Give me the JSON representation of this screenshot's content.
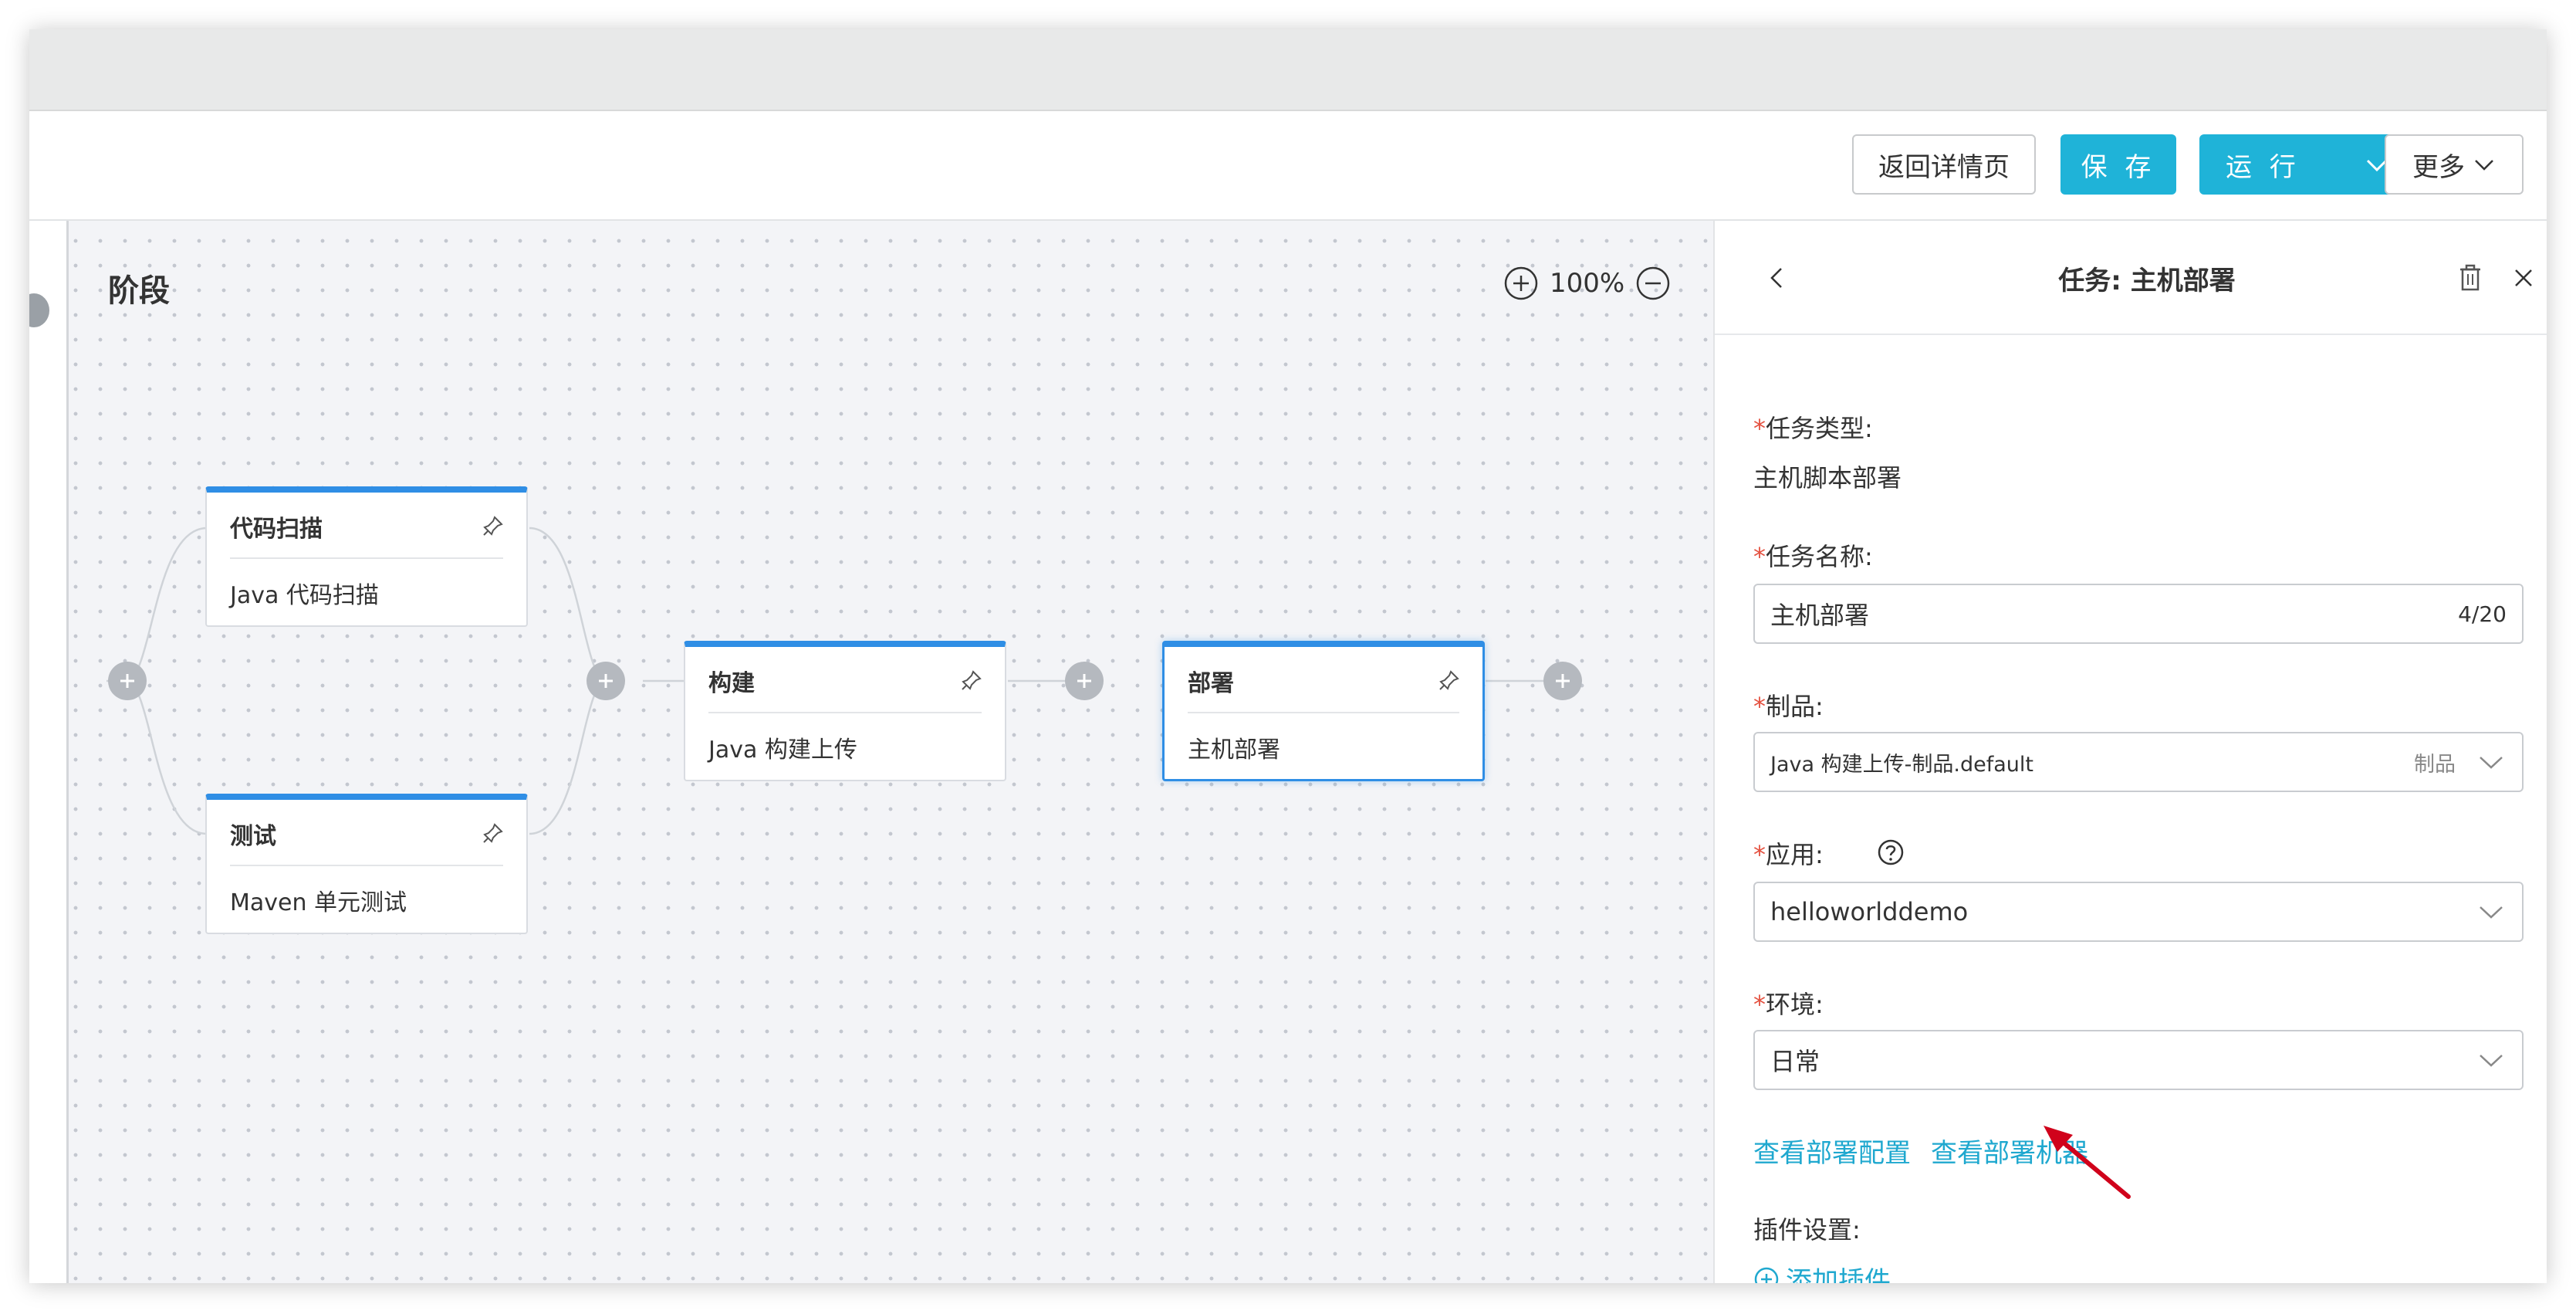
{
  "toolbar": {
    "back_label": "返回详情页",
    "save_label": "保 存",
    "run_label": "运 行",
    "more_label": "更多"
  },
  "canvas": {
    "title": "阶段",
    "zoom": "100%",
    "nodes": [
      {
        "title": "代码扫描",
        "desc": "Java 代码扫描"
      },
      {
        "title": "测试",
        "desc": "Maven 单元测试"
      },
      {
        "title": "构建",
        "desc": "Java 构建上传"
      },
      {
        "title": "部署",
        "desc": "主机部署"
      }
    ],
    "selected_node": "部署"
  },
  "panel": {
    "title": "任务: 主机部署",
    "required_mark": "*",
    "task_type": {
      "label": "任务类型:",
      "value": "主机脚本部署"
    },
    "task_name": {
      "label": "任务名称:",
      "value": "主机部署",
      "count": "4/20"
    },
    "artifact": {
      "label": "制品:",
      "value": "Java 构建上传-制品.default",
      "hint": "制品"
    },
    "app": {
      "label": "应用:",
      "value": "helloworlddemo"
    },
    "env": {
      "label": "环境:",
      "value": "日常"
    },
    "links": {
      "deploy_config": "查看部署配置",
      "deploy_machines": "查看部署机器"
    },
    "plugins": {
      "label": "插件设置:",
      "add_label": "添加插件"
    }
  },
  "colors": {
    "accent": "#1fb3d8",
    "link": "#1fa8cf",
    "node_top": "#2f8ee5",
    "required": "#e4503f",
    "annotation_arrow": "#d0021b"
  }
}
